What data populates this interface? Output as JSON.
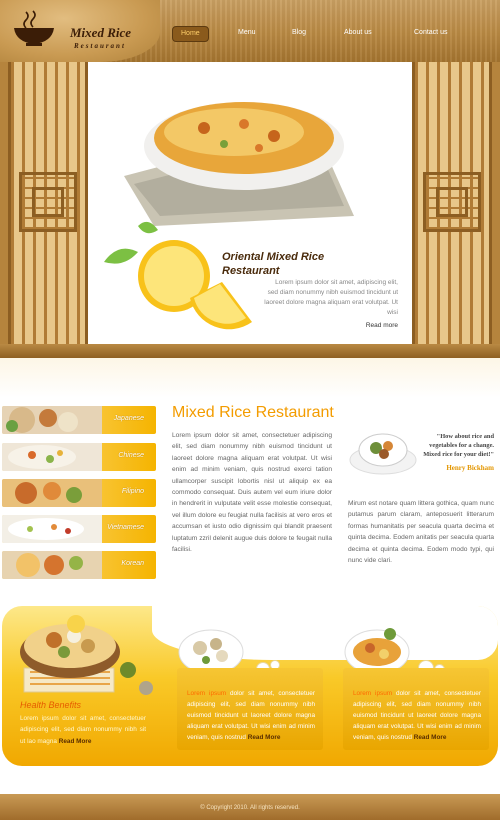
{
  "brand": {
    "title": "Mixed Rice",
    "subtitle": "Restaurant"
  },
  "nav": [
    {
      "label": "Home",
      "active": true
    },
    {
      "label": "Menu",
      "active": false
    },
    {
      "label": "Blog",
      "active": false
    },
    {
      "label": "About us",
      "active": false
    },
    {
      "label": "Contact us",
      "active": false
    }
  ],
  "hero": {
    "title_line1": "Oriental Mixed Rice",
    "title_line2": "Restaurant",
    "text": "Lorem ipsum dolor sit amet, adipiscing elit, sed diam nonummy nibh euismod tincidunt ut laoreet dolore magna aliquam erat volutpat. Ut wisi",
    "more": "Read more"
  },
  "cuisines": [
    {
      "label": "Japanese"
    },
    {
      "label": "Chinese"
    },
    {
      "label": "Filipino"
    },
    {
      "label": "Vietnamese"
    },
    {
      "label": "Korean"
    }
  ],
  "intro": {
    "title": "Mixed Rice Restaurant",
    "text": "Lorem ipsum dolor sit amet, consectetuer adipiscing elit, sed diam nonummy nibh euismod tincidunt ut laoreet dolore magna aliquam erat volutpat. Ut wisi enim ad minim veniam, quis nostrud exerci tation ullamcorper suscipit lobortis nisl ut aliquip ex ea commodo consequat. Duis autem vel eum iriure dolor in hendrerit in vulputate velit esse molestie consequat, vel illum dolore eu feugiat nulla facilisis at vero eros et accumsan et iusto odio dignissim qui blandit praesent luptatum zzril delenit augue duis dolore te feugait nulla facilisi."
  },
  "quote": {
    "text": "\"How about rice and vegetables for a change. Mixed rice for your diet!\"",
    "author": "Henry Bickham"
  },
  "side_text": "Mirum est notare quam littera gothica, quam nunc putamus parum claram, anteposuerit litterarum formas humanitatis per seacula quarta decima et quinta decima. Eodem anitatis per seacula quarta decima et quinta decima. Eodem modo typi, qui nunc vide clari.",
  "health": {
    "title": "Health Benefits",
    "text": "Lorem ipsum dolor sit amet, consectetuer adipiscing elit, sed diam nonummy nibh sit ut lao magna",
    "more": "Read More"
  },
  "cards": [
    {
      "lead": "Lorem ipsum",
      "text": "dolor sit amet, consectetuer adipiscing elit, sed diam nonummy nibh euismod tincidunt ut laoreet dolore magna aliquam erat volutpat. Ut wisi enim ad minim veniam, quis nostrud",
      "more": "Read More"
    },
    {
      "lead": "Lorem ipsum",
      "text": "dolor sit amet, consectetuer adipiscing elit, sed diam nonummy nibh euismod tincidunt ut laoreet dolore magna aliquam erat volutpat. Ut wisi enim ad minim veniam, quis nostrud",
      "more": "Read More"
    }
  ],
  "footer": {
    "copyright": "© Copyright 2010. All rights reserved."
  },
  "colors": {
    "accent": "#f39c00",
    "wood": "#b98943",
    "band": "#f9c928"
  }
}
